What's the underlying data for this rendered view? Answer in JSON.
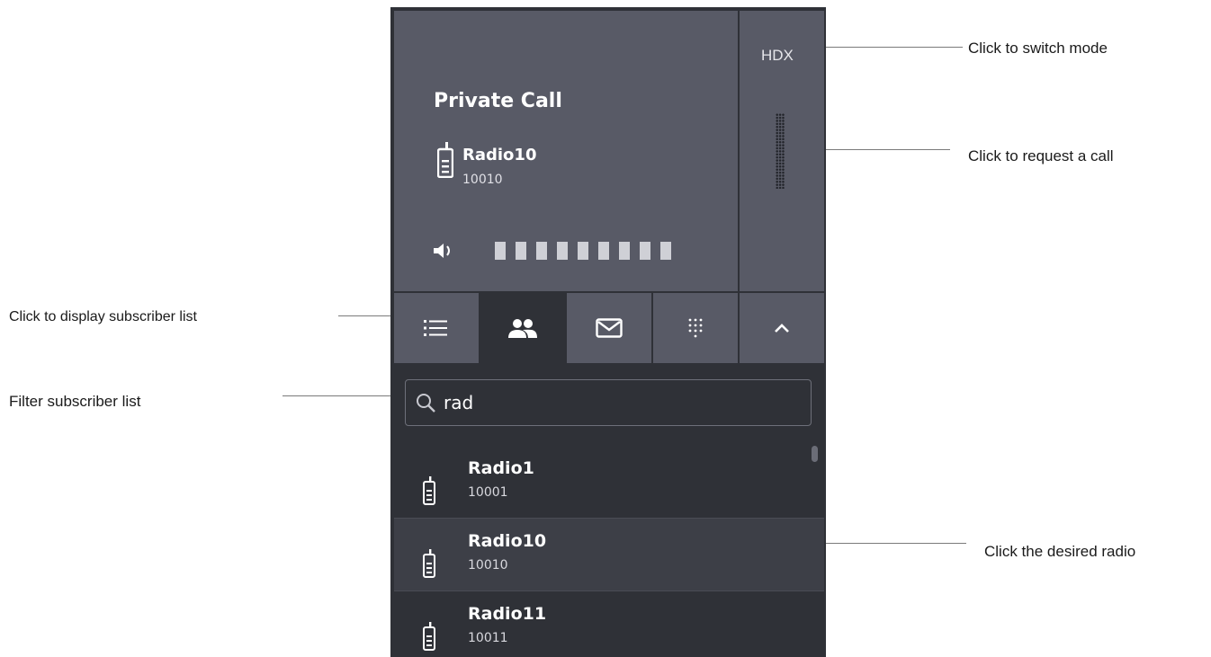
{
  "callouts": {
    "switch_mode": "Click to switch mode",
    "request_call": "Click to request a call",
    "display_subscriber_list": "Click to display subscriber list",
    "filter_subscriber_list": "Filter subscriber list",
    "desired_radio": "Click the desired radio"
  },
  "call": {
    "type": "Private Call",
    "name": "Radio10",
    "id": "10010",
    "icon": "radio-icon",
    "volume_icon": "speaker-icon",
    "volume_level": 1.0
  },
  "mode_button": {
    "label": "HDX"
  },
  "ptt": {
    "icon": "push-to-talk-grille-icon"
  },
  "tabs": [
    {
      "icon": "list-icon",
      "active": false
    },
    {
      "icon": "subscribers-icon",
      "active": true
    },
    {
      "icon": "message-icon",
      "active": false
    },
    {
      "icon": "keypad-icon",
      "active": false
    },
    {
      "icon": "chevron-up-icon",
      "active": false
    }
  ],
  "search": {
    "value": "rad",
    "icon": "search-icon"
  },
  "subscribers": [
    {
      "name": "Radio1",
      "id": "10001",
      "selected": false
    },
    {
      "name": "Radio10",
      "id": "10010",
      "selected": true
    },
    {
      "name": "Radio11",
      "id": "10011",
      "selected": false
    }
  ],
  "colors": {
    "panel_bg": "#2f3137",
    "tile_bg": "#585a66",
    "selected_row": "#3d3f47",
    "text": "#ffffff"
  }
}
